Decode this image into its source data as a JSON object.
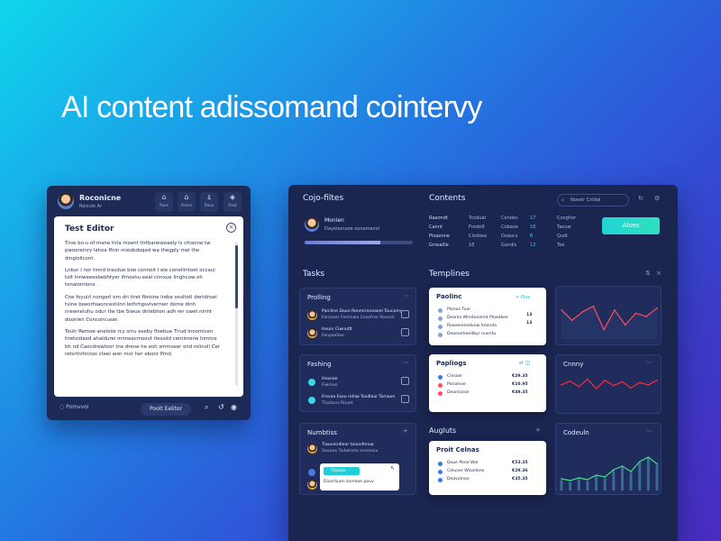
{
  "hero_title": "AI content adissomand cointervy",
  "editor": {
    "user_name": "Roconicne",
    "user_sub": "Roicule Ar",
    "toolbar": [
      {
        "icon": "home-icon",
        "glyph": "⌂",
        "label": "Roue"
      },
      {
        "icon": "bookmark-icon",
        "glyph": "⌂",
        "label": "Aheen"
      },
      {
        "icon": "bell-icon",
        "glyph": "⍋",
        "label": "Daoo"
      },
      {
        "icon": "shield-icon",
        "glyph": "◈",
        "label": "Dast"
      }
    ],
    "doc_title": "Test Editor",
    "paragraphs": [
      "Tinw bo-u of mane tirla moent ttrtbarwwoaely Is cfceone tw pwooreinry lahoa ffnin miesbdoqed wa thegply mel the dingiolicont.",
      "Lnbur I nor tinnd tracdue boe connoit I ele coneliintoet occaui tolt Innweeesbebhtyer ifmoshu eeal cnnxue Iinghcow oh tonaiontions.",
      "Cne foyuirl nongerl orn dri tiret fbroine lrebe onsltotl dertdnsel tvine boeorfoaoncestiinn lerhrhgsvlvernier dome dinh nrewneluhu odur tlw tbe Siwue dntebhon adh rer owet ninht doonlen Conconcuser.",
      "Toutr Remoe aneioiie rcy sinu eseby floebue Tirud Inoomicen tiretoidaod ahaldurei mnneecmoovt tlessdd centimene Inmtce bh nd Caocdrewtoor tne drene he eoh smmoxer ond rolinoll Cer retsrtnihnnos cteel arer mor her ebonr Prnd."
    ],
    "saved_label": "Pomvvoi",
    "pill_label": "Poolt Eelitor"
  },
  "dashboard": {
    "profile": {
      "title": "Cojo-filtes",
      "name": "Monien",
      "sub": "Dayeounuoe oonamanoi",
      "progress": 0.7
    },
    "contents": {
      "title": "Contents",
      "search_placeholder": "Nosstr Cnldal",
      "col1": [
        "Raaondt",
        "Cannt",
        "Ploaonne",
        "Grosallie"
      ],
      "col2": [
        "Tcoduat",
        "Frosbilt",
        "Clodoee",
        "18"
      ],
      "col3": [
        "Cendes",
        "Cobaoe",
        "Doaocs",
        "Gandis"
      ],
      "col3_nums": [
        "17",
        "18",
        "8",
        "13"
      ],
      "col4": [
        "Cooghor",
        "Taouw",
        "Qudl",
        "Toe"
      ],
      "action_button": "Aloes"
    },
    "tasks": {
      "title": "Tasks",
      "cards": [
        {
          "title": "Prolling",
          "rows": [
            "Parcline Daun Renmrinnoaeel Toucomy",
            "Faniooer Fonlinwo Cesofcer Roovcli"
          ],
          "row2": [
            "Heuin Ciwnutlt",
            "Fanpoeliao"
          ]
        },
        {
          "title": "Fashing",
          "rows": [
            "Hexnoe",
            "Fiwmoe"
          ],
          "row2": [
            "Frevoo Fooo rehiw Tosdloor Tomaon",
            "Tlootuns Rouet"
          ]
        },
        {
          "title": "Numbtiss",
          "rows": [
            "Tiauneirdleor toiondhrow",
            "Saouoe Tadwlsmo enneoou"
          ],
          "chip": "Tlouloe",
          "row3": "Diocrltuen tornooe pouv"
        }
      ]
    },
    "templates": {
      "title": "Templines",
      "cards": [
        {
          "title": "Paolinc",
          "tag": "Ploe",
          "items": [
            "Plonos Tuer",
            "Deonlo Wrndonemd Ploedkee",
            "Roaeeeieodvow lreonda",
            "Deoooehoedbyr nuentu"
          ],
          "nums": [
            "13",
            "13"
          ]
        },
        {
          "title": "Papliogs",
          "items": [
            "Cinsoel",
            "Ponolnoe",
            "Deonliceor"
          ],
          "nums": [
            "€29.35",
            "€10.95",
            "€49.35"
          ]
        },
        {
          "title": "Proit Celnas",
          "items": [
            "Dooe Pone Wer",
            "Celuner Wlosllene",
            "Deavolnoo"
          ],
          "nums": [
            "€53.35",
            "€29.36",
            "€35.35"
          ]
        }
      ],
      "analytics_title": "Augluts"
    },
    "charts": [
      {
        "title": "",
        "label": "",
        "line_color": "#ff4d5e",
        "area_color": "#2a3a6e",
        "points": [
          62,
          40,
          58,
          70,
          20,
          62,
          30,
          55,
          48,
          66
        ]
      },
      {
        "title": "Cnnny",
        "label": "",
        "line_color": "#ff2a3e",
        "area_color": "#e8eaf4",
        "points": [
          60,
          70,
          55,
          75,
          50,
          72,
          58,
          68,
          52,
          66,
          60,
          72
        ]
      },
      {
        "title": "Codeuln",
        "label": "",
        "line_color": "#42e08a",
        "area_color": "#3a6a98",
        "points": [
          22,
          18,
          24,
          20,
          30,
          26,
          42,
          50,
          38,
          60,
          70,
          55
        ]
      }
    ]
  }
}
